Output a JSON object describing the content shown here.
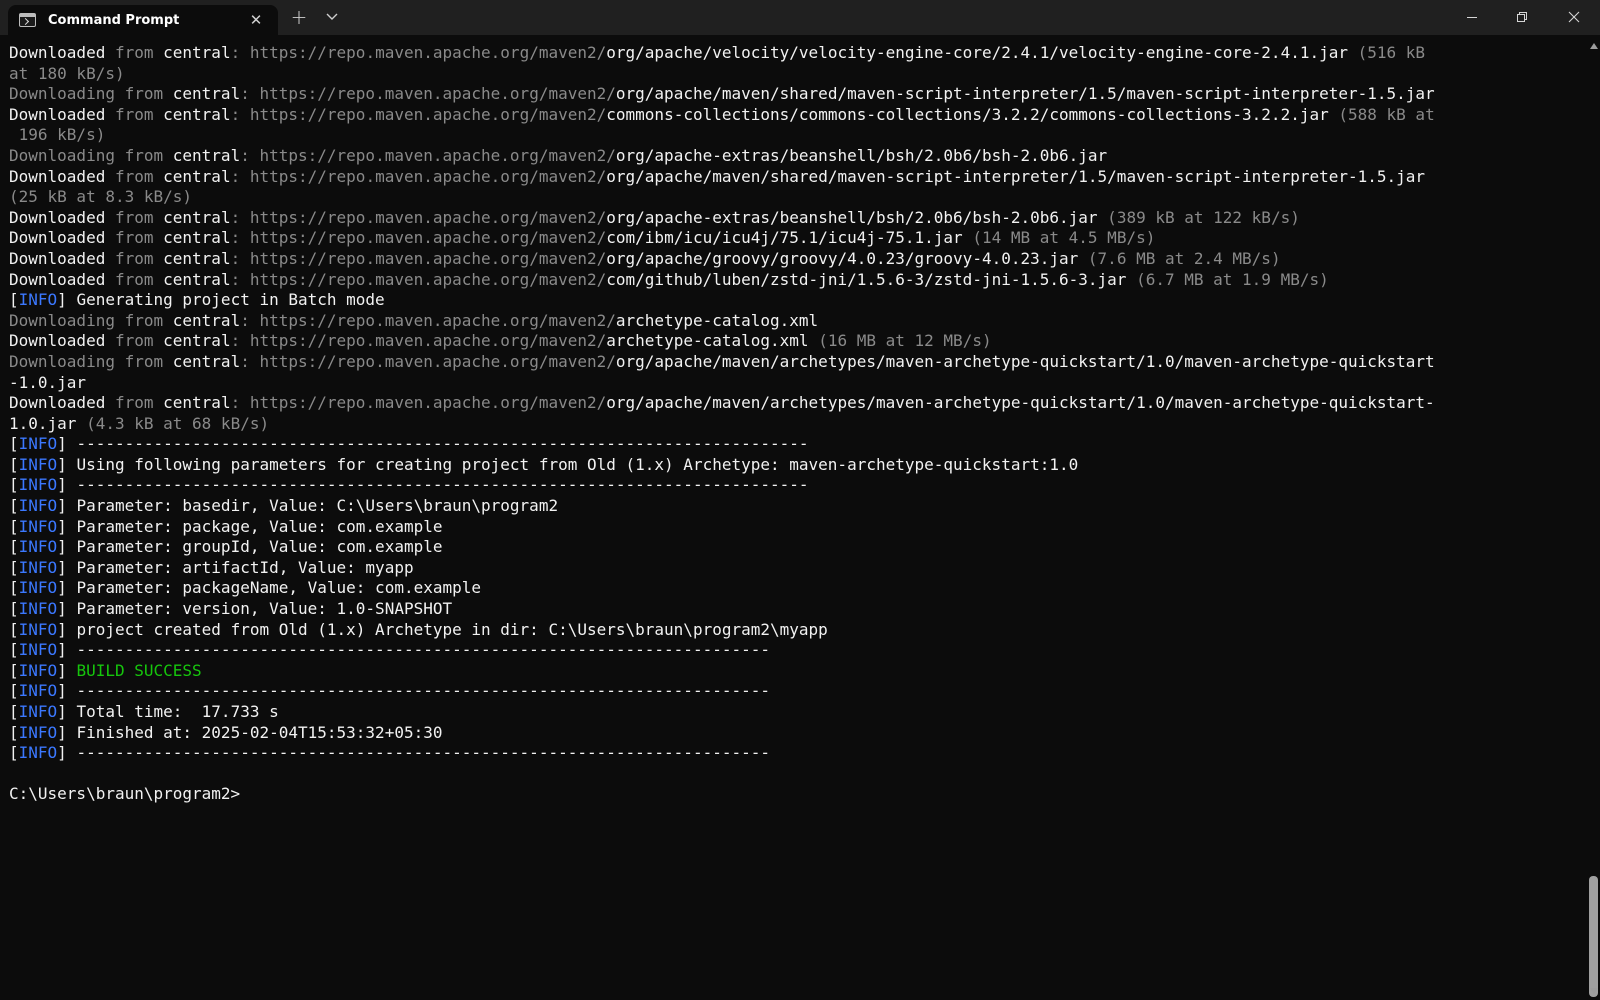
{
  "window": {
    "tab_title": "Command Prompt",
    "tab_close_glyph": "✕",
    "new_tab_glyph": "+",
    "icons": [
      "terminal-app-icon",
      "close-icon",
      "plus-icon",
      "chevron-down-icon",
      "minimize-icon",
      "maximize-icon",
      "close-window-icon"
    ]
  },
  "colors": {
    "background": "#0c0c0c",
    "titlebar": "#202020",
    "text_bright": "#f2f2f2",
    "text_dim": "#8a8a8a",
    "info_blue": "#3b78ff",
    "success_green": "#16c60c"
  },
  "terminal": {
    "lines": [
      [
        [
          "w",
          "Downloaded "
        ],
        [
          "g",
          "from "
        ],
        [
          "w",
          "central"
        ],
        [
          "g",
          ": https://repo.maven.apache.org/maven2/"
        ],
        [
          "w",
          "org/apache/velocity/velocity-engine-core/2.4.1/velocity-engine-core-2.4.1.jar"
        ],
        [
          "g",
          " (516 kB"
        ]
      ],
      [
        [
          "g",
          "at 180 kB/s)"
        ]
      ],
      [
        [
          "g",
          "Downloading from "
        ],
        [
          "w",
          "central"
        ],
        [
          "g",
          ": https://repo.maven.apache.org/maven2/"
        ],
        [
          "w",
          "org/apache/maven/shared/maven-script-interpreter/1.5/maven-script-interpreter-1.5.jar"
        ]
      ],
      [
        [
          "w",
          "Downloaded "
        ],
        [
          "g",
          "from "
        ],
        [
          "w",
          "central"
        ],
        [
          "g",
          ": https://repo.maven.apache.org/maven2/"
        ],
        [
          "w",
          "commons-collections/commons-collections/3.2.2/commons-collections-3.2.2.jar"
        ],
        [
          "g",
          " (588 kB at"
        ]
      ],
      [
        [
          "g",
          " 196 kB/s)"
        ]
      ],
      [
        [
          "g",
          "Downloading from "
        ],
        [
          "w",
          "central"
        ],
        [
          "g",
          ": https://repo.maven.apache.org/maven2/"
        ],
        [
          "w",
          "org/apache-extras/beanshell/bsh/2.0b6/bsh-2.0b6.jar"
        ]
      ],
      [
        [
          "w",
          "Downloaded "
        ],
        [
          "g",
          "from "
        ],
        [
          "w",
          "central"
        ],
        [
          "g",
          ": https://repo.maven.apache.org/maven2/"
        ],
        [
          "w",
          "org/apache/maven/shared/maven-script-interpreter/1.5/maven-script-interpreter-1.5.jar"
        ]
      ],
      [
        [
          "g",
          "(25 kB at 8.3 kB/s)"
        ]
      ],
      [
        [
          "w",
          "Downloaded "
        ],
        [
          "g",
          "from "
        ],
        [
          "w",
          "central"
        ],
        [
          "g",
          ": https://repo.maven.apache.org/maven2/"
        ],
        [
          "w",
          "org/apache-extras/beanshell/bsh/2.0b6/bsh-2.0b6.jar"
        ],
        [
          "g",
          " (389 kB at 122 kB/s)"
        ]
      ],
      [
        [
          "w",
          "Downloaded "
        ],
        [
          "g",
          "from "
        ],
        [
          "w",
          "central"
        ],
        [
          "g",
          ": https://repo.maven.apache.org/maven2/"
        ],
        [
          "w",
          "com/ibm/icu/icu4j/75.1/icu4j-75.1.jar"
        ],
        [
          "g",
          " (14 MB at 4.5 MB/s)"
        ]
      ],
      [
        [
          "w",
          "Downloaded "
        ],
        [
          "g",
          "from "
        ],
        [
          "w",
          "central"
        ],
        [
          "g",
          ": https://repo.maven.apache.org/maven2/"
        ],
        [
          "w",
          "org/apache/groovy/groovy/4.0.23/groovy-4.0.23.jar"
        ],
        [
          "g",
          " (7.6 MB at 2.4 MB/s)"
        ]
      ],
      [
        [
          "w",
          "Downloaded "
        ],
        [
          "g",
          "from "
        ],
        [
          "w",
          "central"
        ],
        [
          "g",
          ": https://repo.maven.apache.org/maven2/"
        ],
        [
          "w",
          "com/github/luben/zstd-jni/1.5.6-3/zstd-jni-1.5.6-3.jar"
        ],
        [
          "g",
          " (6.7 MB at 1.9 MB/s)"
        ]
      ],
      [
        [
          "w",
          "["
        ],
        [
          "b",
          "INFO"
        ],
        [
          "w",
          "] Generating project in Batch mode"
        ]
      ],
      [
        [
          "g",
          "Downloading from "
        ],
        [
          "w",
          "central"
        ],
        [
          "g",
          ": https://repo.maven.apache.org/maven2/"
        ],
        [
          "w",
          "archetype-catalog.xml"
        ]
      ],
      [
        [
          "w",
          "Downloaded "
        ],
        [
          "g",
          "from "
        ],
        [
          "w",
          "central"
        ],
        [
          "g",
          ": https://repo.maven.apache.org/maven2/"
        ],
        [
          "w",
          "archetype-catalog.xml"
        ],
        [
          "g",
          " (16 MB at 12 MB/s)"
        ]
      ],
      [
        [
          "g",
          "Downloading from "
        ],
        [
          "w",
          "central"
        ],
        [
          "g",
          ": https://repo.maven.apache.org/maven2/"
        ],
        [
          "w",
          "org/apache/maven/archetypes/maven-archetype-quickstart/1.0/maven-archetype-quickstart"
        ]
      ],
      [
        [
          "w",
          "-1.0.jar"
        ]
      ],
      [
        [
          "w",
          "Downloaded "
        ],
        [
          "g",
          "from "
        ],
        [
          "w",
          "central"
        ],
        [
          "g",
          ": https://repo.maven.apache.org/maven2/"
        ],
        [
          "w",
          "org/apache/maven/archetypes/maven-archetype-quickstart/1.0/maven-archetype-quickstart-"
        ]
      ],
      [
        [
          "w",
          "1.0.jar"
        ],
        [
          "g",
          " (4.3 kB at 68 kB/s)"
        ]
      ],
      [
        [
          "w",
          "["
        ],
        [
          "b",
          "INFO"
        ],
        [
          "w",
          "] ----------------------------------------------------------------------------"
        ]
      ],
      [
        [
          "w",
          "["
        ],
        [
          "b",
          "INFO"
        ],
        [
          "w",
          "] Using following parameters for creating project from Old (1.x) Archetype: maven-archetype-quickstart:1.0"
        ]
      ],
      [
        [
          "w",
          "["
        ],
        [
          "b",
          "INFO"
        ],
        [
          "w",
          "] ----------------------------------------------------------------------------"
        ]
      ],
      [
        [
          "w",
          "["
        ],
        [
          "b",
          "INFO"
        ],
        [
          "w",
          "] Parameter: basedir, Value: C:\\Users\\braun\\program2"
        ]
      ],
      [
        [
          "w",
          "["
        ],
        [
          "b",
          "INFO"
        ],
        [
          "w",
          "] Parameter: package, Value: com.example"
        ]
      ],
      [
        [
          "w",
          "["
        ],
        [
          "b",
          "INFO"
        ],
        [
          "w",
          "] Parameter: groupId, Value: com.example"
        ]
      ],
      [
        [
          "w",
          "["
        ],
        [
          "b",
          "INFO"
        ],
        [
          "w",
          "] Parameter: artifactId, Value: myapp"
        ]
      ],
      [
        [
          "w",
          "["
        ],
        [
          "b",
          "INFO"
        ],
        [
          "w",
          "] Parameter: packageName, Value: com.example"
        ]
      ],
      [
        [
          "w",
          "["
        ],
        [
          "b",
          "INFO"
        ],
        [
          "w",
          "] Parameter: version, Value: 1.0-SNAPSHOT"
        ]
      ],
      [
        [
          "w",
          "["
        ],
        [
          "b",
          "INFO"
        ],
        [
          "w",
          "] project created from Old (1.x) Archetype in dir: C:\\Users\\braun\\program2\\myapp"
        ]
      ],
      [
        [
          "w",
          "["
        ],
        [
          "b",
          "INFO"
        ],
        [
          "w",
          "] ------------------------------------------------------------------------"
        ]
      ],
      [
        [
          "w",
          "["
        ],
        [
          "b",
          "INFO"
        ],
        [
          "w",
          "] "
        ],
        [
          "s",
          "BUILD SUCCESS"
        ]
      ],
      [
        [
          "w",
          "["
        ],
        [
          "b",
          "INFO"
        ],
        [
          "w",
          "] ------------------------------------------------------------------------"
        ]
      ],
      [
        [
          "w",
          "["
        ],
        [
          "b",
          "INFO"
        ],
        [
          "w",
          "] Total time:  17.733 s"
        ]
      ],
      [
        [
          "w",
          "["
        ],
        [
          "b",
          "INFO"
        ],
        [
          "w",
          "] Finished at: 2025-02-04T15:53:32+05:30"
        ]
      ],
      [
        [
          "w",
          "["
        ],
        [
          "b",
          "INFO"
        ],
        [
          "w",
          "] ------------------------------------------------------------------------"
        ]
      ],
      [],
      [
        [
          "w",
          "C:\\Users\\braun\\program2>"
        ]
      ]
    ]
  },
  "scrollbar": {
    "position_fraction": 1.0
  }
}
